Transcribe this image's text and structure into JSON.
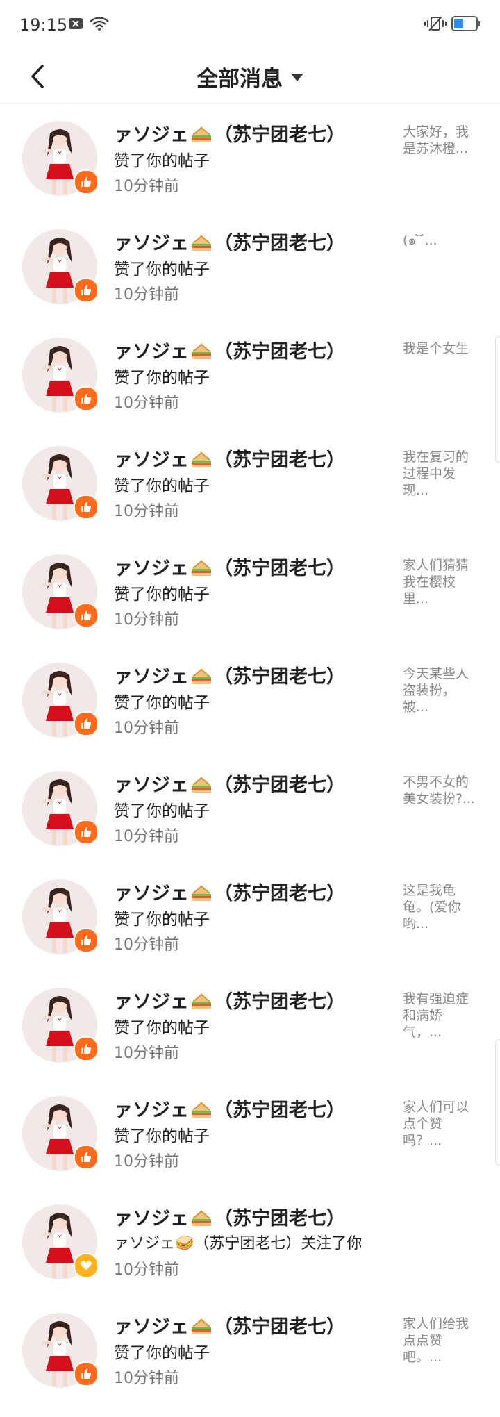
{
  "status": {
    "time": "19:15"
  },
  "header": {
    "title": "全部消息"
  },
  "notifications": [
    {
      "name_prefix": "ァソジェ",
      "name_suffix": "（苏宁团老七）",
      "action": "赞了你的帖子",
      "time": "10分钟前",
      "preview": "大家好，我是苏沐橙...",
      "type": "like"
    },
    {
      "name_prefix": "ァソジェ",
      "name_suffix": "（苏宁团老七）",
      "action": "赞了你的帖子",
      "time": "10分钟前",
      "preview": "(๑ ̄̀ ̄́...",
      "type": "like"
    },
    {
      "name_prefix": "ァソジェ",
      "name_suffix": "（苏宁团老七）",
      "action": "赞了你的帖子",
      "time": "10分钟前",
      "preview": "我是个女生",
      "type": "like"
    },
    {
      "name_prefix": "ァソジェ",
      "name_suffix": "（苏宁团老七）",
      "action": "赞了你的帖子",
      "time": "10分钟前",
      "preview": "我在复习的过程中发现...",
      "type": "like"
    },
    {
      "name_prefix": "ァソジェ",
      "name_suffix": "（苏宁团老七）",
      "action": "赞了你的帖子",
      "time": "10分钟前",
      "preview": "家人们猜猜我在樱校里...",
      "type": "like"
    },
    {
      "name_prefix": "ァソジェ",
      "name_suffix": "（苏宁团老七）",
      "action": "赞了你的帖子",
      "time": "10分钟前",
      "preview": "今天某些人盗装扮，被...",
      "type": "like"
    },
    {
      "name_prefix": "ァソジェ",
      "name_suffix": "（苏宁团老七）",
      "action": "赞了你的帖子",
      "time": "10分钟前",
      "preview": "不男不女的美女装扮?...",
      "type": "like"
    },
    {
      "name_prefix": "ァソジェ",
      "name_suffix": "（苏宁团老七）",
      "action": "赞了你的帖子",
      "time": "10分钟前",
      "preview": "这是我龟龟。(爱你哟...",
      "type": "like"
    },
    {
      "name_prefix": "ァソジェ",
      "name_suffix": "（苏宁团老七）",
      "action": "赞了你的帖子",
      "time": "10分钟前",
      "preview": "我有强迫症和病娇气，...",
      "type": "like"
    },
    {
      "name_prefix": "ァソジェ",
      "name_suffix": "（苏宁团老七）",
      "action": "赞了你的帖子",
      "time": "10分钟前",
      "preview": "家人们可以点个赞吗？...",
      "type": "like"
    },
    {
      "name_prefix": "ァソジェ",
      "name_suffix": "（苏宁团老七）",
      "action": "ァソジェ🥪（苏宁团老七）关注了你",
      "time": "10分钟前",
      "preview": "",
      "type": "follow"
    },
    {
      "name_prefix": "ァソジェ",
      "name_suffix": "（苏宁团老七）",
      "action": "赞了你的帖子",
      "time": "10分钟前",
      "preview": "家人们给我点点赞吧。...",
      "type": "like"
    }
  ],
  "colors": {
    "like_badge": "#ff6b1a",
    "follow_badge": "#ffb21e",
    "preview_text": "#8a8a8a"
  }
}
